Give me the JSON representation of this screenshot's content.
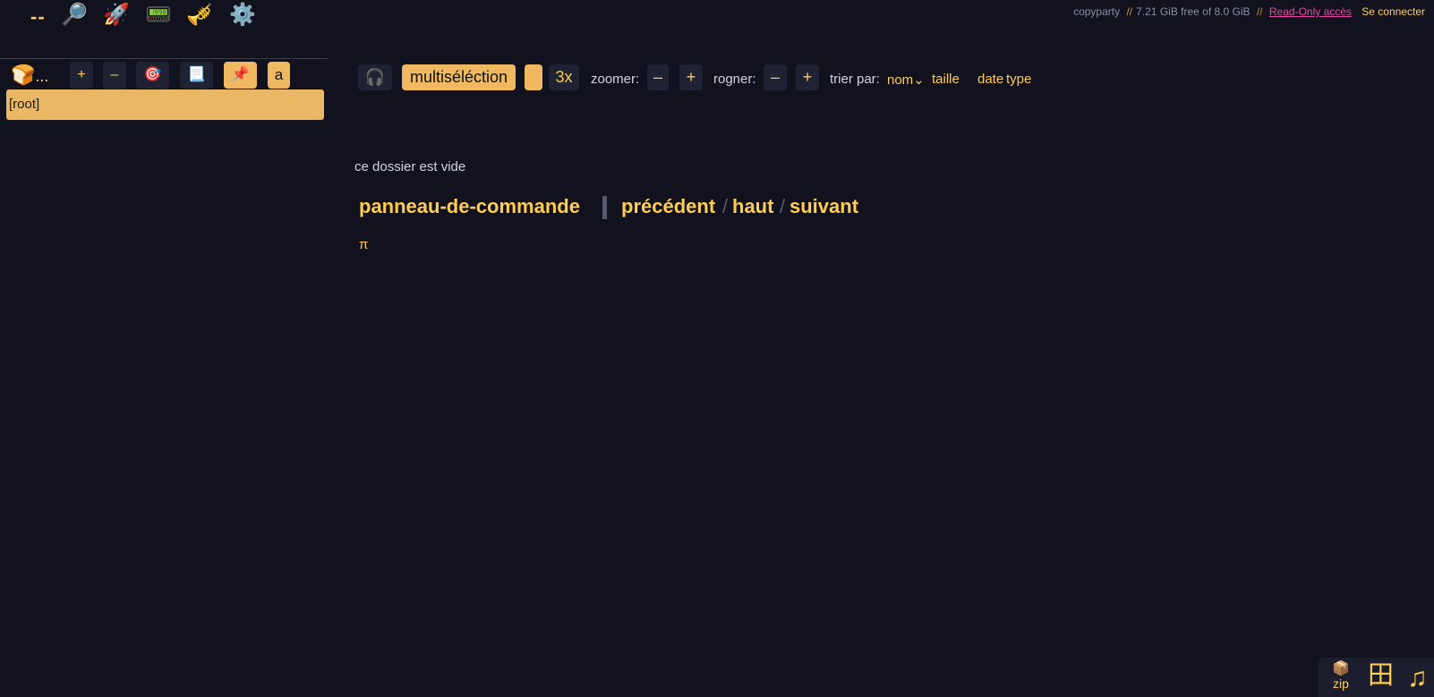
{
  "topbar": {
    "dashes_label": "--",
    "icons": [
      "🔎",
      "🚀",
      "📟",
      "🎺",
      "⚙️"
    ]
  },
  "info": {
    "app_name": "copyparty",
    "sep": "//",
    "disk": "7.21 GiB free of 8.0 GiB",
    "access": "Read-Only accès",
    "login": "Se connecter"
  },
  "tree": {
    "bread_icon": "🍞",
    "bread_ellipsis": "...",
    "plus": "+",
    "minus": "–",
    "target_icon": "🎯",
    "page_icon": "📃",
    "pin_icon": "📌",
    "a_label": "a",
    "root_label": "[root]"
  },
  "main_toolbar": {
    "headphones_icon": "🎧",
    "multiselect_label": "multiséléction",
    "speed_label": "3x",
    "zoom_label": "zoomer:",
    "crop_label": "rogner:",
    "minus": "–",
    "plus": "+",
    "sort_label": "trier par:",
    "sort_name": "nom⌄",
    "sort_size": "taille",
    "sort_date": "date",
    "sort_type": "type"
  },
  "content": {
    "empty_message": "ce dossier est vide",
    "control_panel": "panneau-de-commande",
    "prev": "précédent",
    "up": "haut",
    "next": "suivant",
    "slash": "/",
    "pi": "π"
  },
  "widget": {
    "zip_icon": "📦",
    "zip_label": "zip",
    "grid_icon": "田",
    "music_icon": "♫"
  }
}
